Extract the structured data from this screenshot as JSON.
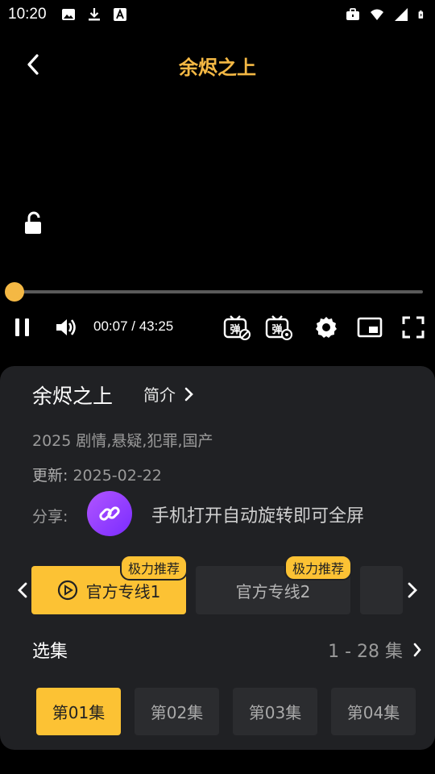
{
  "status": {
    "time": "10:20",
    "left_icons": [
      "image-icon",
      "download-icon",
      "a-icon"
    ],
    "right_icons": [
      "briefcase-icon",
      "wifi-icon",
      "signal-icon",
      "battery-icon"
    ]
  },
  "header": {
    "title": "余烬之上",
    "back_icon": "chevron-left-icon"
  },
  "player": {
    "progress": 0.003,
    "time_display": "00:07 / 43:25",
    "accent": "#f4b844"
  },
  "info": {
    "title": "余烬之上",
    "intro_label": "简介",
    "year_genre": "2025 剧情,悬疑,犯罪,国产",
    "update_label": "更新:",
    "update_date": "2025-02-22",
    "share_label": "分享:",
    "rotate_hint": "手机打开自动旋转即可全屏"
  },
  "lines": [
    {
      "label": "官方专线1",
      "badge": "极力推荐",
      "active": true
    },
    {
      "label": "官方专线2",
      "badge": "极力推荐",
      "active": false
    }
  ],
  "episodes": {
    "heading": "选集",
    "range": "1 - 28 集",
    "items": [
      {
        "label": "第01集",
        "active": true
      },
      {
        "label": "第02集",
        "active": false
      },
      {
        "label": "第03集",
        "active": false
      },
      {
        "label": "第04集",
        "active": false
      }
    ]
  },
  "colors": {
    "accent": "#fcc234",
    "title": "#f4b844",
    "panel": "#202124"
  }
}
